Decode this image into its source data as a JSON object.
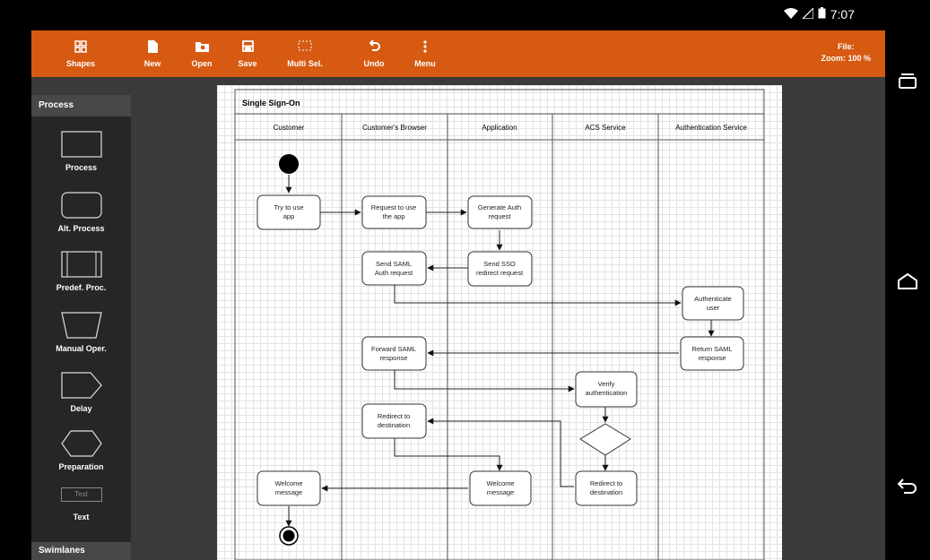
{
  "status_bar": {
    "time": "7:07"
  },
  "toolbar": {
    "shapes_label": "Shapes",
    "new_label": "New",
    "open_label": "Open",
    "save_label": "Save",
    "multisel_label": "Multi Sel.",
    "undo_label": "Undo",
    "menu_label": "Menu",
    "file_label": "File:",
    "zoom_label": "Zoom: 100 %"
  },
  "sidebar": {
    "section_process": "Process",
    "section_swimlanes": "Swimlanes",
    "shapes": [
      "Process",
      "Alt. Process",
      "Predef. Proc.",
      "Manual Oper.",
      "Delay",
      "Preparation",
      "Text"
    ],
    "text_shape_placeholder": "Text"
  },
  "diagram": {
    "title": "Single Sign-On",
    "lanes": [
      "Customer",
      "Customer's Browser",
      "Application",
      "ACS Service",
      "Authentication Service"
    ],
    "nodes": {
      "try": [
        "Try to use",
        "app"
      ],
      "request": [
        "Request to use",
        "the app"
      ],
      "generate": [
        "Generate Auth",
        "request"
      ],
      "send_sso": [
        "Send SSO",
        "redirect request"
      ],
      "send_saml": [
        "Send SAML",
        "Auth request"
      ],
      "authenticate": [
        "Authenticate",
        "user"
      ],
      "return_saml": [
        "Return SAML",
        "response"
      ],
      "forward_saml": [
        "Forward SAML",
        "response"
      ],
      "verify": [
        "Verify",
        "authentication"
      ],
      "redirect_dest_browser": [
        "Redirect to",
        "destination"
      ],
      "redirect_dest_acs": [
        "Redirect to",
        "destination"
      ],
      "welcome_app": [
        "Welcome",
        "message"
      ],
      "welcome_customer": [
        "Welcome",
        "message"
      ]
    }
  },
  "colors": {
    "toolbar": "#d65a12",
    "statusbar": "#000000",
    "sidebar": "#262626",
    "sidebar_header": "#484848",
    "workspace": "#3a3a3a"
  },
  "icons": {
    "shapes": "grid-icon",
    "new": "new-file-icon",
    "open": "folder-icon",
    "save": "save-icon",
    "multisel": "dashed-selection-icon",
    "undo": "undo-icon",
    "menu": "more-vert-icon",
    "wifi": "wifi-icon",
    "signal": "signal-icon",
    "battery": "battery-icon",
    "nav_recent": "recent-apps-icon",
    "nav_home": "home-icon",
    "nav_back": "back-icon"
  }
}
